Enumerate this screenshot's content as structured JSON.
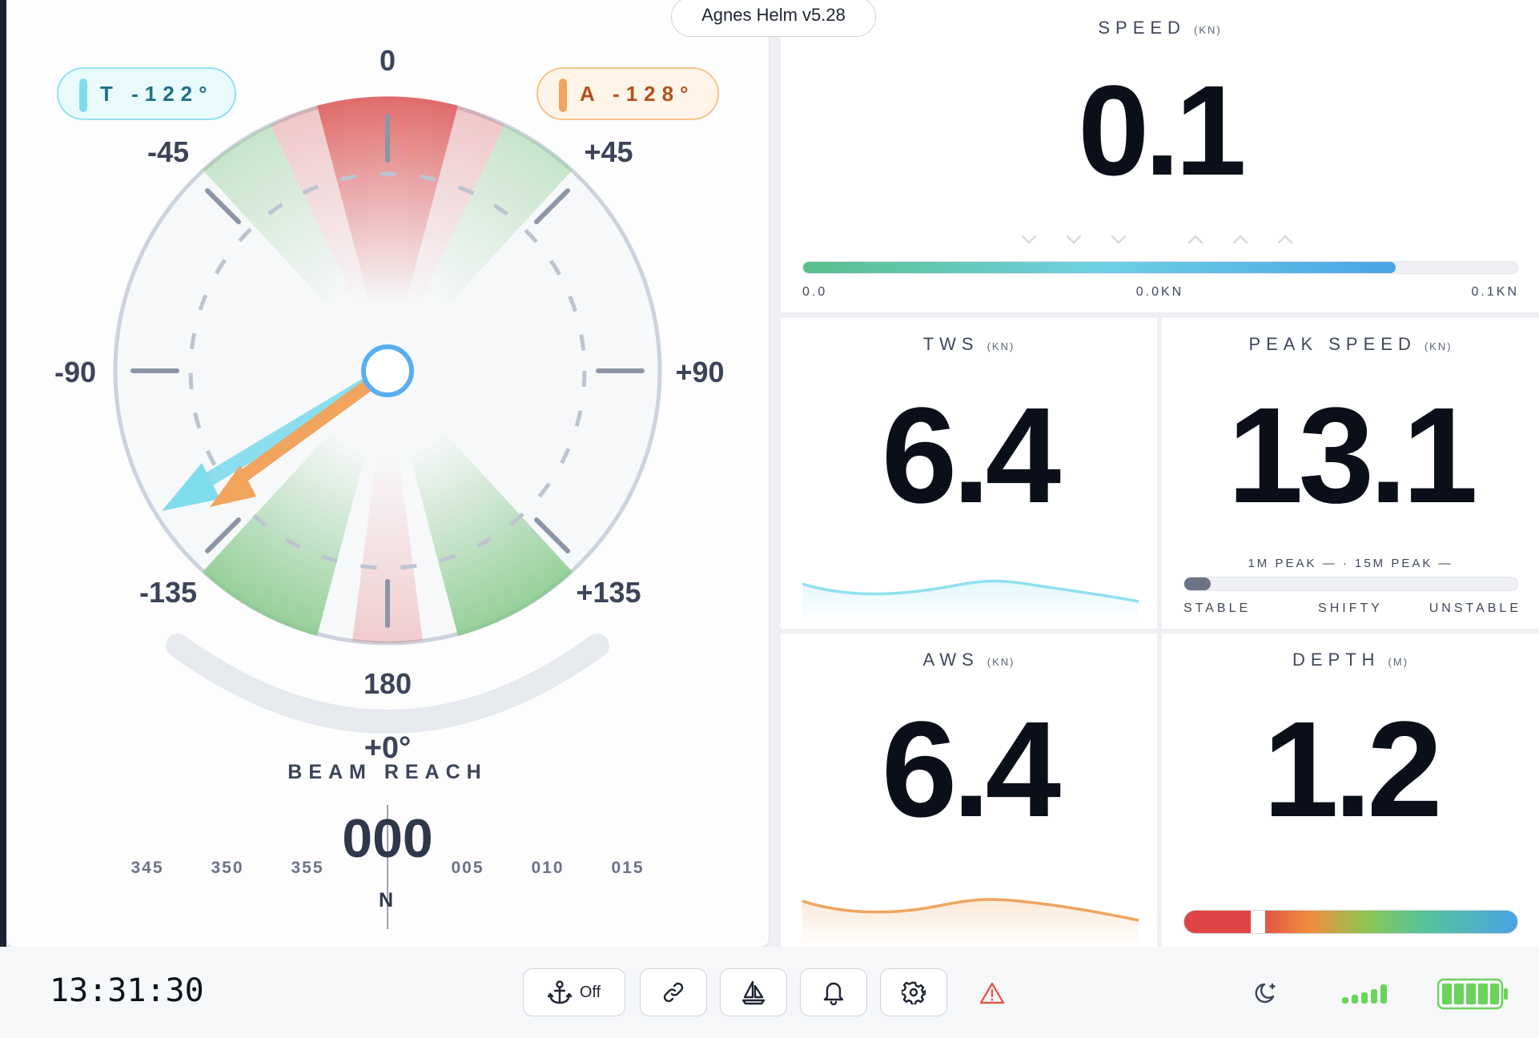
{
  "app": {
    "version_label": "Agnes Helm v5.28"
  },
  "wind_panel": {
    "true_angle_pill": "T -122°",
    "apparent_angle_pill": "A -128°",
    "dial_labels": {
      "top": "0",
      "bottom": "180",
      "left": "-90",
      "right": "+90",
      "upper_left": "-45",
      "upper_right": "+45",
      "lower_left": "-135",
      "lower_right": "+135"
    },
    "heel_readout": "+0°",
    "point_of_sail": "BEAM REACH",
    "compass": {
      "heading": "000",
      "cardinal": "N",
      "ticks": [
        "345",
        "350",
        "355",
        "005",
        "010",
        "015"
      ]
    },
    "true_wind_angle_deg": -122,
    "apparent_wind_angle_deg": -128,
    "colors": {
      "true_wind": "#7fdced",
      "apparent_wind": "#f0a45e",
      "no_go_zone": "#e06666",
      "good_zone": "#86c98a"
    }
  },
  "speed": {
    "title": "SPEED",
    "unit": "(KN)",
    "value": "0.1",
    "bar_min": "0.0",
    "bar_mid": "0.0KN",
    "bar_max": "0.1KN",
    "bar_fill_fraction": 0.83,
    "trend_down_icons": 3,
    "trend_up_icons": 3
  },
  "tws": {
    "title": "TWS",
    "unit": "(KN)",
    "value": "6.4",
    "sparkline_color": "#8fe0f0"
  },
  "peak_speed": {
    "title": "PEAK SPEED",
    "unit": "(KN)",
    "value": "13.1",
    "peaks_label": "1M PEAK — · 15M PEAK —",
    "stability_fill_fraction": 0.08,
    "stability_labels": [
      "STABLE",
      "SHIFTY",
      "UNSTABLE"
    ]
  },
  "aws": {
    "title": "AWS",
    "unit": "(KN)",
    "value": "6.4",
    "sparkline_color": "#f0a45e"
  },
  "depth": {
    "title": "DEPTH",
    "unit": "(M)",
    "value": "1.2",
    "marker_fraction": 0.2
  },
  "status_bar": {
    "clock": "13:31:30",
    "anchor_label": "Off",
    "colors": {
      "signal": "#6ad35a",
      "battery": "#6ad35a",
      "warning": "#e25b4f"
    }
  }
}
